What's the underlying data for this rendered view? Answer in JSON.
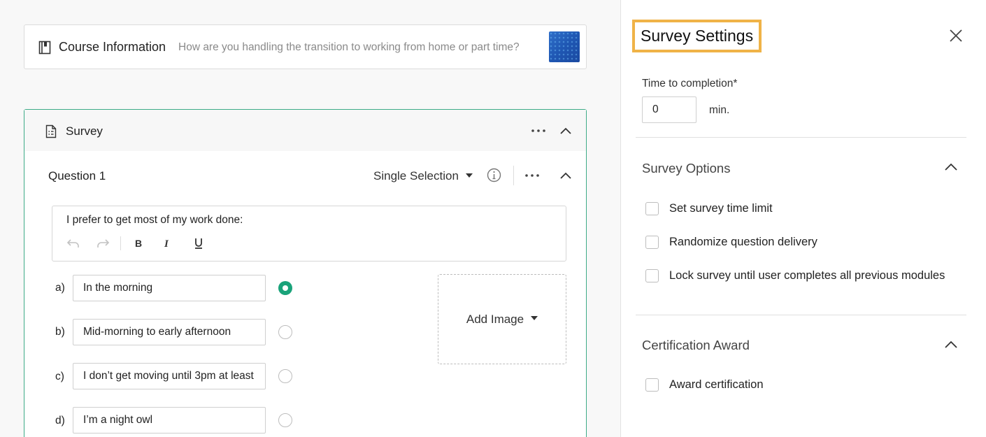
{
  "course": {
    "title": "Course Information",
    "description": "How are you handling the transition to working from home or part time?"
  },
  "survey": {
    "title": "Survey",
    "question": {
      "title": "Question 1",
      "type": "Single Selection",
      "prompt": "I prefer to get most of my work done:",
      "options": [
        {
          "letter": "a)",
          "text": "In the morning",
          "selected": true
        },
        {
          "letter": "b)",
          "text": "Mid-morning to early afternoon",
          "selected": false
        },
        {
          "letter": "c)",
          "text": "I don’t get moving until 3pm at least",
          "selected": false
        },
        {
          "letter": "d)",
          "text": "I’m a night owl",
          "selected": false
        }
      ],
      "add_image_label": "Add Image"
    }
  },
  "settings": {
    "title": "Survey Settings",
    "time_label": "Time to completion*",
    "time_value": "0",
    "time_unit": "min.",
    "options_section": {
      "title": "Survey Options",
      "items": [
        {
          "label": "Set survey time limit",
          "checked": false
        },
        {
          "label": "Randomize question delivery",
          "checked": false
        },
        {
          "label": "Lock survey until user completes all previous modules",
          "checked": false
        }
      ]
    },
    "certification_section": {
      "title": "Certification Award",
      "items": [
        {
          "label": "Award certification",
          "checked": false
        }
      ]
    }
  },
  "colors": {
    "accent_green": "#1aa37a",
    "highlight_orange": "#f0b347"
  }
}
